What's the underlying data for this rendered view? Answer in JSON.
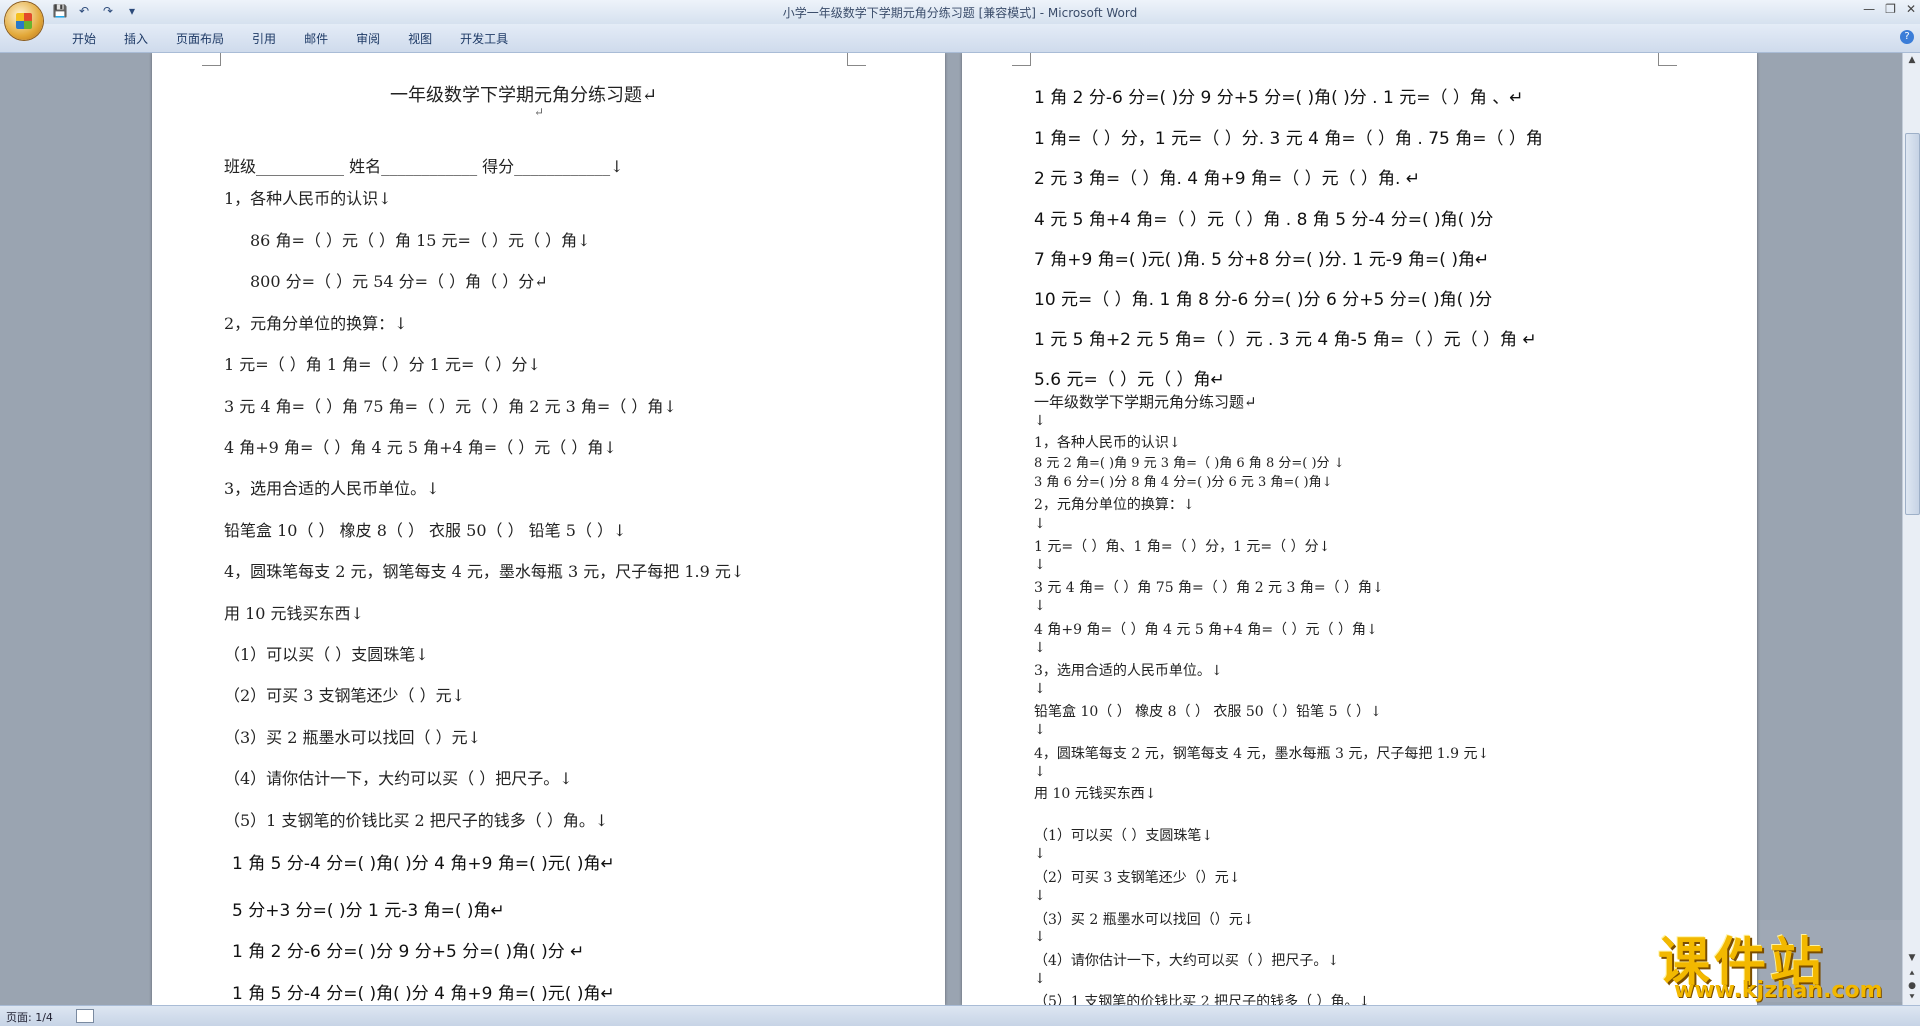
{
  "window": {
    "title": "小学一年级数学下学期元角分练习题 [兼容模式] - Microsoft Word"
  },
  "ribbon": {
    "tabs": [
      "开始",
      "插入",
      "页面布局",
      "引用",
      "邮件",
      "审阅",
      "视图",
      "开发工具"
    ]
  },
  "status": {
    "page": "页面: 1/4"
  },
  "watermark": {
    "text": "课件站",
    "url": "www.kjzhan.com"
  },
  "page1": {
    "title": "一年级数学下学期元角分练习题↵",
    "blank": "↵",
    "header_line": "班级___________     姓名____________       得分____________↓",
    "lines": [
      "1，各种人民币的认识↓",
      "86 角=（    ）元（    ）角    15 元=（    ）元（    ）角↓",
      "800 分=（     ）元    54 分=（   ）角（   ）分↵",
      "2，元角分单位的换算：↓",
      "1 元=（    ）角       1 角=（    ）分      1 元=（     ）分↓",
      "3 元 4 角=（    ）角    75 角=（    ）元（     ）角    2 元 3 角=（    ）角↓",
      "4 角+9 角=（    ）角       4 元 5 角+4 角=（    ）元（    ）角↓",
      "3，选用合适的人民币单位。↓",
      "铅笔盒 10（    ）      橡皮 8（    ）      衣服 50（    ）      铅笔 5（    ）↓",
      "4，圆珠笔每支 2 元，钢笔每支 4 元，墨水每瓶 3 元，尺子每把 1.9 元↓",
      " 用 10 元钱买东西↓",
      "（1）可以买（            ）支圆珠笔↓",
      "（2）可买 3 支钢笔还少（        ）元↓",
      "（3）买 2 瓶墨水可以找回（     ）元↓",
      "（4）请你估计一下，大约可以买（    ）把尺子。↓",
      "（5）1 支钢笔的价钱比买 2 把尺子的钱多（      ）角。↓"
    ],
    "bold_lines": [
      "1 角 5 分-4 分=(    )角(     )分              4 角+9 角=(     )元(     )角↵",
      "5 分+3 分=(     )分                               1 元-3 角=(     )角↵",
      "1 角 2 分-6 分=(     )分                          9 分+5 分=(     )角(     )分  ↵",
      "1 角 5 分-4 分=(     )角(     )分              4 角+9 角=(     )元(     )角↵"
    ]
  },
  "page2": {
    "bold_lines": [
      "1 角 2 分-6 分=(     )分     9 分+5 分=(     )角(     )分 .    1 元=（     ）角 、↵",
      "1 角=（     ）分，1 元=（     ）分.  3 元 4 角=（     ）角 . 75 角=（     ）角",
      "2 元 3 角=（     ）角.   4 角+9 角=（     ）元（     ）角.    ↵",
      "4 元 5 角+4 角=（     ）元（     ）角 .        8 角 5 分-4 分=(     )角(     )分",
      "7 角+9 角=(     )元(     )角.     5 分+8 分=(     )分.   1 元-9 角=(     )角↵",
      "10 元=（     ）角.   1 角 8 分-6 分=(     )分      6 分+5 分=(     )角(     )分",
      "1 元 5 角+2 元 5 角=（     ）元 . 3 元 4 角-5 角=（     ）元（     ）角      ↵",
      "5.6 元=（     ）元（     ）角↵"
    ],
    "title": "一年级数学下学期元角分练习题↵",
    "small_lines": [
      "↓",
      "1，各种人民币的认识↓",
      "8 元 2 角=(      )角             9 元 3 角=（      )角         6 角 8 分=(      )分         ↓",
      "3 角 6 分=(      )分              8 角 4 分=(     )分          6 元 3 角=(      )角↓",
      "2，元角分单位的换算：↓",
      "↓",
      "1 元=（ ）角、1 角=（ ）分，1 元=（ ）分↓",
      "↓",
      "3 元 4 角=（ ）角  75 角=（ ）角  2 元 3 角=（ ）角↓",
      "↓",
      "4 角+9 角=（ ）角  4 元 5 角+4 角=（ ）元（ ）角↓",
      "↓",
      "3，选用合适的人民币单位。↓",
      "↓",
      "铅笔盒 10（ ）  橡皮 8（ ）  衣服 50（ ）铅笔 5（ ）↓",
      "↓",
      "4，圆珠笔每支 2 元，钢笔每支 4 元，墨水每瓶 3 元，尺子每把 1.9 元↓",
      "↓",
      "        用 10 元钱买东西↓",
      "          （1）可以买（          ）支圆珠笔↓",
      "↓",
      "          （2）可买 3 支钢笔还少（）元↓",
      "↓",
      "          （3）买 2 瓶墨水可以找回（）元↓",
      "↓",
      "          （4）请你估计一下，大约可以买（ ）把尺子。↓",
      "↓",
      "          （5）1 支钢笔的价钱比买 2 把尺子的钱多（ ）角。↓"
    ]
  }
}
